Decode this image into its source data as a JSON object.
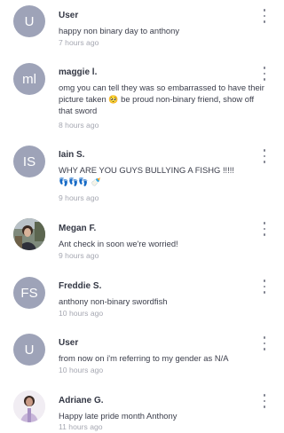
{
  "comments": [
    {
      "initials": "U",
      "user": "User",
      "text": "happy non binary day to anthony",
      "time": "7 hours ago"
    },
    {
      "initials": "ml",
      "user": "maggie l.",
      "text_before": "omg you can tell they was so embarrassed to have their picture taken ",
      "emoji": "🥺",
      "text_after": " be proud non-binary  friend, show off that sword",
      "time": "8 hours ago"
    },
    {
      "initials": "IS",
      "user": "Iain S.",
      "text_before": "WHY ARE YOU GUYS BULLYING A FISHG !!!!! ",
      "emoji": "👣👣👣 🍼",
      "time": "9 hours ago"
    },
    {
      "user": "Megan F.",
      "text": "Ant check in soon we're worried!",
      "time": "9 hours ago",
      "avatar_icon": "profile-photo"
    },
    {
      "initials": "FS",
      "user": "Freddie S.",
      "text": "anthony non-binary swordfish",
      "time": "10 hours ago"
    },
    {
      "initials": "U",
      "user": "User",
      "text": "from now on i'm referring to my gender as N/A",
      "time": "10 hours ago"
    },
    {
      "user": "Adriane G.",
      "text": "Happy late pride month Anthony",
      "time": "11 hours ago",
      "avatar_icon": "profile-photo"
    }
  ],
  "colors": {
    "avatar_bg": "#9ea3b8",
    "username": "#333744",
    "body_text": "#3a3d4a",
    "timestamp": "#a6a8b2"
  },
  "icons": {
    "more": "vertical-ellipsis-icon"
  }
}
